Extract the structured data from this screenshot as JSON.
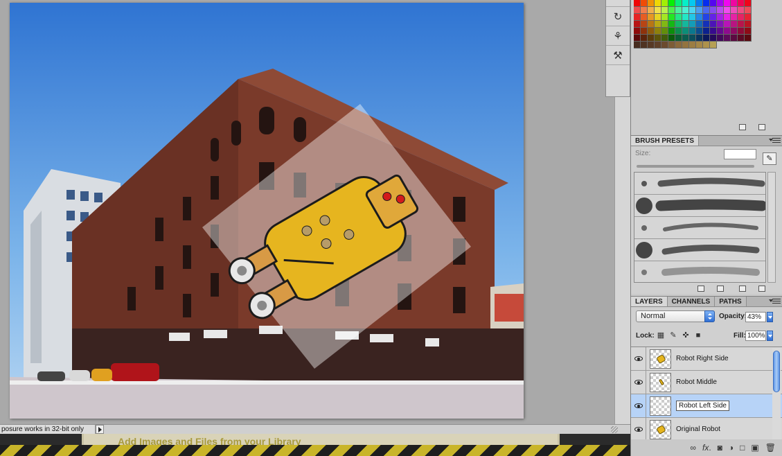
{
  "status": {
    "text": "posure works in 32-bit only"
  },
  "web_page": {
    "library_text": "Add Images and Files from your Library"
  },
  "tools": [
    {
      "icon": "history-brush-icon"
    },
    {
      "icon": "clone-source-icon"
    },
    {
      "icon": "tool-presets-icon"
    }
  ],
  "brush_presets": {
    "tab_label": "BRUSH PRESETS",
    "size_label": "Size:",
    "size_value": ""
  },
  "layers_panel": {
    "tabs": [
      "LAYERS",
      "CHANNELS",
      "PATHS"
    ],
    "blend_mode": "Normal",
    "opacity_label": "Opacity:",
    "opacity_value": "43%",
    "lock_label": "Lock:",
    "fill_label": "Fill:",
    "fill_value": "100%",
    "layers": [
      {
        "name": "Robot Right Side",
        "visible": true,
        "selected": false
      },
      {
        "name": "Robot Middle",
        "visible": true,
        "selected": false
      },
      {
        "name": "Robot Left Side",
        "visible": true,
        "selected": true
      },
      {
        "name": "Original Robot",
        "visible": true,
        "selected": false
      }
    ],
    "footer_icons": [
      "link-icon",
      "fx-icon",
      "mask-icon",
      "adjustment-icon",
      "group-icon",
      "new-layer-icon",
      "trash-icon"
    ]
  },
  "colors": {
    "accent": "#3876d8",
    "selected_row": "#b7d3f7",
    "robot_yellow": "#e6b51f",
    "sky": "#5a9be0"
  }
}
